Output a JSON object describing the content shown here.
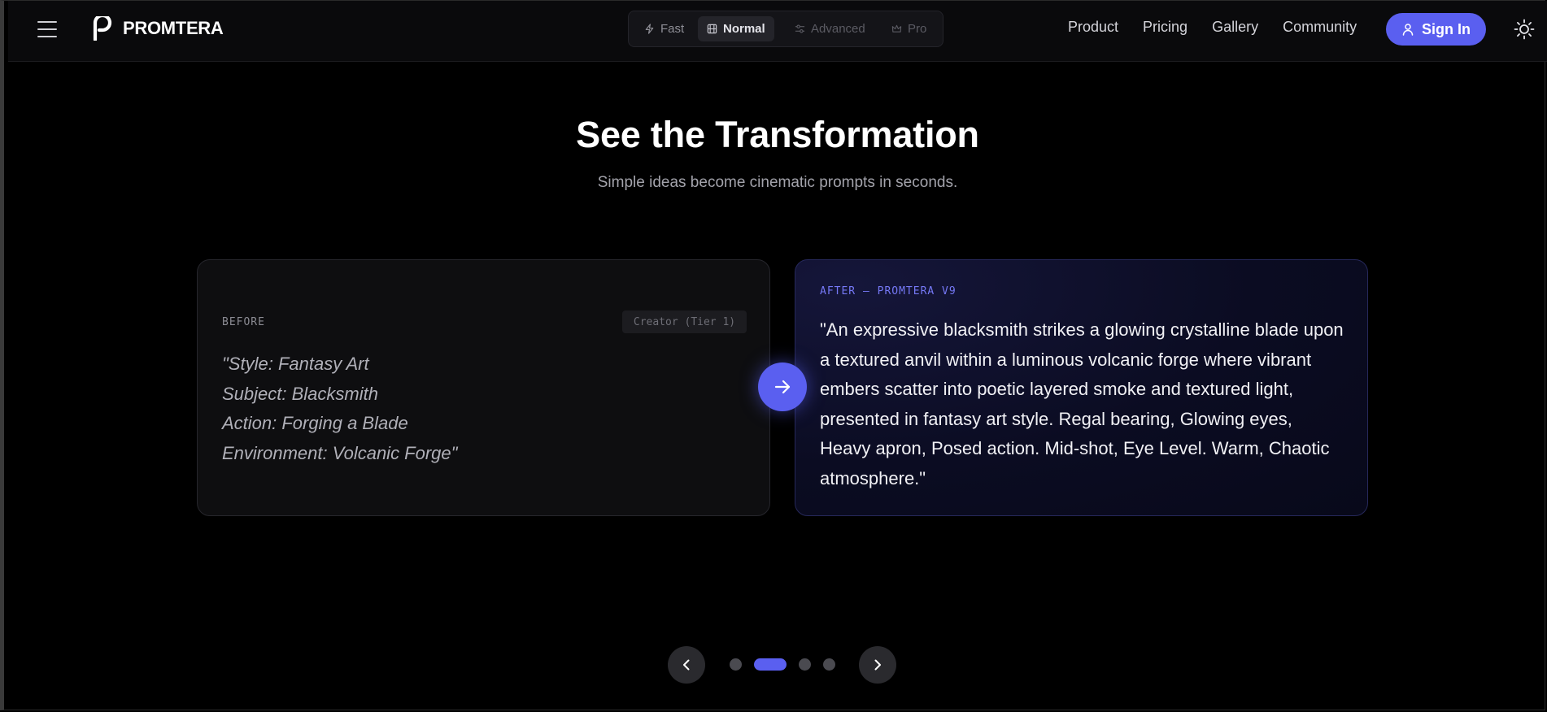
{
  "header": {
    "brand_name": "PROMTERA",
    "modes": [
      {
        "label": "Fast",
        "icon": "lightning-icon",
        "state": "enabled"
      },
      {
        "label": "Normal",
        "icon": "film-icon",
        "state": "active"
      },
      {
        "label": "Advanced",
        "icon": "sliders-icon",
        "state": "disabled"
      },
      {
        "label": "Pro",
        "icon": "crown-icon",
        "state": "disabled"
      }
    ],
    "nav_links": [
      "Product",
      "Pricing",
      "Gallery",
      "Community"
    ],
    "sign_in_label": "Sign In"
  },
  "hero": {
    "title": "See the Transformation",
    "subtitle": "Simple ideas become cinematic prompts in seconds."
  },
  "before_card": {
    "tag": "BEFORE",
    "badge": "Creator (Tier 1)",
    "lines": [
      "\"Style: Fantasy Art",
      "Subject: Blacksmith",
      "Action: Forging a Blade",
      "Environment: Volcanic Forge\""
    ]
  },
  "after_card": {
    "tag": "AFTER — PROMTERA V9",
    "text": "\"An expressive blacksmith strikes a glowing crystalline blade upon a textured anvil within a luminous volcanic forge where vibrant embers scatter into poetic layered smoke and textured light, presented in fantasy art style. Regal bearing, Glowing eyes, Heavy apron, Posed action. Mid-shot, Eye Level. Warm, Chaotic atmosphere.\""
  },
  "carousel": {
    "slide_count": 4,
    "active_index": 1
  },
  "colors": {
    "accent": "#5a5ff0",
    "background": "#000000",
    "after_tag": "#7578f5"
  }
}
